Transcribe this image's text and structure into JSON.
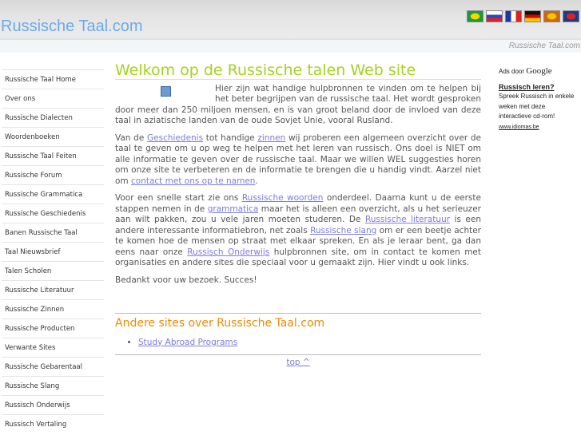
{
  "header": {
    "title": "Russische Taal.com",
    "subtitle": "Russische Taal.com",
    "flags": [
      {
        "name": "brazil",
        "colors": [
          "#1a9a3a",
          "#f5d800"
        ]
      },
      {
        "name": "russia",
        "colors": [
          "#fff",
          "#2a46c8",
          "#d22"
        ]
      },
      {
        "name": "france",
        "colors": [
          "#1a3aa0",
          "#fff",
          "#d22"
        ]
      },
      {
        "name": "germany",
        "colors": [
          "#111",
          "#d00",
          "#f5c400"
        ]
      },
      {
        "name": "spain",
        "colors": [
          "#c61",
          "#f5c400"
        ]
      },
      {
        "name": "uk",
        "colors": [
          "#1a3a8a",
          "#d22"
        ]
      }
    ]
  },
  "sidebar": {
    "items": [
      "Russische Taal Home",
      "Over ons",
      "Russische Dialecten",
      "Woordenboeken",
      "Russische Taal Feiten",
      "Russische Forum",
      "Russische Grammatica",
      "Russische Geschiedenis",
      "Banen Russische Taal",
      "Taal Nieuwsbrief",
      "Talen Scholen",
      "Russische Literatuur",
      "Russische Zinnen",
      "Russische Producten",
      "Verwante Sites",
      "Russische Gebarentaal",
      "Russische Slang",
      "Russisch Onderwijs",
      "Russisch Vertaling"
    ]
  },
  "main": {
    "heading": "Welkom op de Russische talen Web site",
    "p1": "Hier zijn wat handige hulpbronnen te vinden om te helpen bij het beter begrijpen van de russische taal. Het wordt gesproken door meer dan 250 miljoen mensen, en is van groot beland door de invloed van deze taal in aziatische landen van de oude Sovjet Unie, vooral Rusland.",
    "p2": [
      "Van de ",
      "Geschiedenis",
      " tot handige ",
      "zinnen",
      " wij proberen een algemeen overzicht over de taal te geven om u op weg te helpen met het leren van russisch. Ons doel is NIET om alle informatie te geven over de russische taal. Maar we willen WEL suggesties horen om onze site te verbeteren en de informatie te brengen die u handig vindt. Aarzel niet om ",
      "contact met ons op te namen",
      "."
    ],
    "p3": [
      "Voor een snelle start zie ons ",
      "Russische woorden",
      " onderdeel. Daarna kunt u de eerste stappen nemen in de ",
      "grammatica",
      " maar het is alleen een overzicht, als u het serieuzer aan wilt pakken, zou u vele jaren moeten studeren. De ",
      "Russische literatuur",
      " is een andere interessante informatiebron, net zoals ",
      "Russische slang",
      " om er een beetje achter te komen hoe de mensen op straat met elkaar spreken. En als je leraar bent, ga dan eens naar onze ",
      "Russisch Onderwijs",
      " hulpbronnen site, om in contact te komen met organisaties en andere sites die speciaal voor u gemaakt zijn. Hier vindt u ook links."
    ],
    "p4": "Bedankt voor uw bezoek. Succes!",
    "other_heading": "Andere sites over Russische Taal.com",
    "other_links": [
      "Study Abroad Programs"
    ],
    "top_link": "top ^"
  },
  "ads": {
    "label": "Ads door",
    "brand": "Google",
    "title": "Russisch leren?",
    "text": "Spreek Russisch in enkele weken met deze interactieve cd-rom!",
    "url": "www.idiomas.be"
  }
}
